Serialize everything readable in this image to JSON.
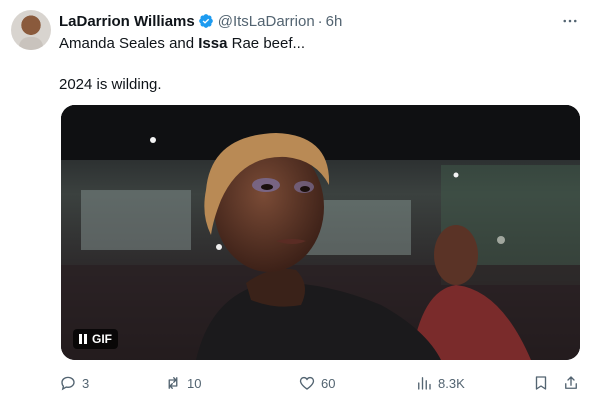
{
  "author": {
    "display_name": "LaDarrion Williams",
    "handle": "@ItsLaDarrion",
    "separator": "·",
    "time": "6h"
  },
  "tweet": {
    "line1_part1": "Amanda Seales and ",
    "line1_bold": "Issa",
    "line1_part2": " Rae beef...",
    "line2": "2024 is wilding."
  },
  "media": {
    "badge_label": "GIF",
    "icon": "pause-icon"
  },
  "actions": {
    "replies": "3",
    "reposts": "10",
    "likes": "60",
    "views": "8.3K"
  },
  "colors": {
    "verified": "#1d9bf0",
    "muted_text": "#536471",
    "text": "#0f1419"
  }
}
